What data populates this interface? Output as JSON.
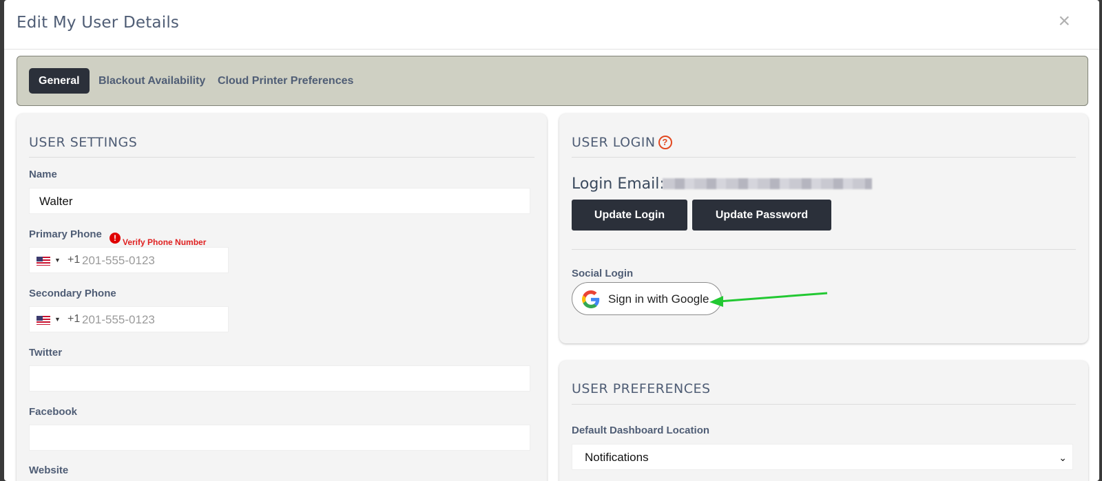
{
  "modal": {
    "title": "Edit My User Details",
    "close_glyph": "×"
  },
  "tabs": [
    {
      "label": "General",
      "active": true
    },
    {
      "label": "Blackout Availability",
      "active": false
    },
    {
      "label": "Cloud Printer Preferences",
      "active": false
    }
  ],
  "user_settings": {
    "title": "USER SETTINGS",
    "name_label": "Name",
    "name_value": "Walter",
    "primary_phone_label": "Primary Phone",
    "verify_icon": "!",
    "verify_text": "Verify Phone Number",
    "primary_phone": {
      "country": "US",
      "dial_code": "+1",
      "placeholder": "201-555-0123"
    },
    "secondary_phone_label": "Secondary Phone",
    "secondary_phone": {
      "country": "US",
      "dial_code": "+1",
      "placeholder": "201-555-0123"
    },
    "twitter_label": "Twitter",
    "twitter_value": "",
    "facebook_label": "Facebook",
    "facebook_value": "",
    "website_label": "Website"
  },
  "user_login": {
    "title": "USER LOGIN",
    "help_icon": "?",
    "login_email_label": "Login Email:",
    "update_login_label": "Update Login",
    "update_password_label": "Update Password",
    "social_login_label": "Social Login",
    "google_button_label": "Sign in with Google"
  },
  "user_preferences": {
    "title": "USER PREFERENCES",
    "dashboard_location_label": "Default Dashboard Location",
    "dashboard_location_value": "Notifications"
  },
  "colors": {
    "dark_button": "#2b303a",
    "tabbar_bg": "#cfd0c3",
    "error_red": "#e02020",
    "help_orange": "#e2481f",
    "annotation_arrow": "#22c832"
  }
}
